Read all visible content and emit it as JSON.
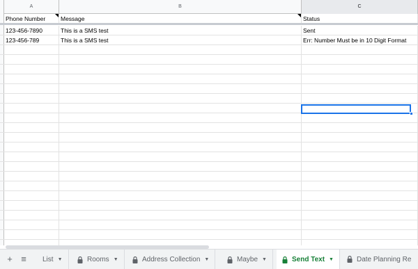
{
  "columns": [
    "A",
    "B",
    "C"
  ],
  "headers": {
    "a": "Phone Number",
    "b": "Message",
    "c": "Status"
  },
  "rows": [
    {
      "phone": "123-456-7890",
      "message": "This is a SMS test",
      "status": "Sent"
    },
    {
      "phone": "123-456-789",
      "message": "This is a SMS test",
      "status": "Err: Number Must be in 10 Digit Format"
    }
  ],
  "tabs": [
    {
      "label": "List",
      "locked": false
    },
    {
      "label": "Rooms",
      "locked": true
    },
    {
      "label": "Address Collection",
      "locked": true
    },
    {
      "label": "Maybe",
      "locked": true
    },
    {
      "label": "Send Text",
      "locked": true,
      "active": true
    },
    {
      "label": "Date Planning Re",
      "locked": true
    }
  ],
  "colors": {
    "active_tab": "#188038",
    "selection": "#1a73e8"
  }
}
